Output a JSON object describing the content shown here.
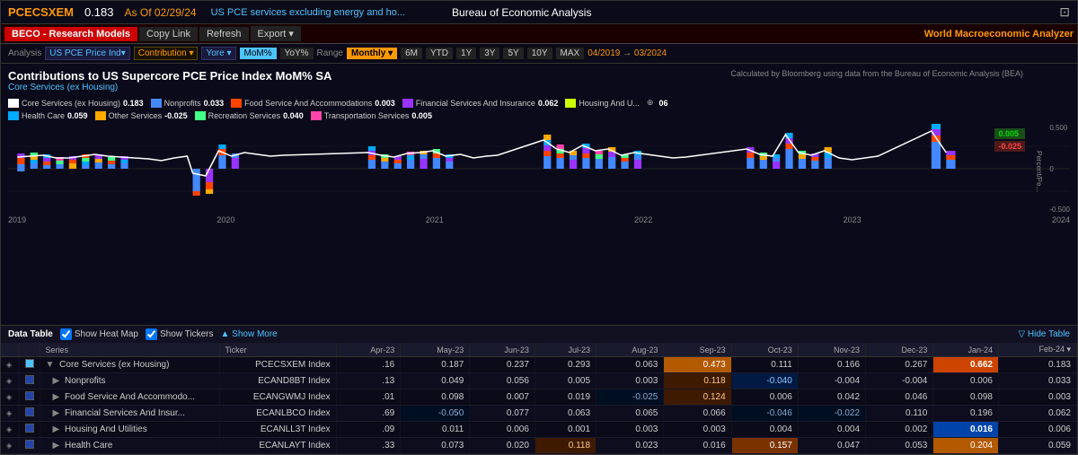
{
  "header": {
    "ticker": "PCECSXEM",
    "value": "0.183",
    "as_of_label": "As Of",
    "date": "02/29/24",
    "series_name": "US PCE services excluding energy and ho...",
    "bureau": "Bureau of Economic Analysis",
    "export_icon": "⊡"
  },
  "toolbar": {
    "beco_label": "BECO - Research Models",
    "copy_link": "Copy Link",
    "refresh": "Refresh",
    "export": "Export ▾",
    "world_macro": "World Macroeconomic Analyzer"
  },
  "analysis_bar": {
    "analysis_label": "Analysis",
    "dropdown1": "US PCE Price Ind▾",
    "dropdown2": "Contribution",
    "dropdown2_arrow": "▾",
    "dropdown3": "Yore",
    "dropdown3_arrow": "▾",
    "mom_btn": "MoM%",
    "yoy_btn": "YoY%",
    "range_label": "Range",
    "monthly_btn": "Monthly ▾",
    "periods": [
      "6M",
      "YTD",
      "1Y",
      "3Y",
      "5Y",
      "10Y",
      "MAX"
    ],
    "date_from": "04/2019",
    "date_arrow": "→",
    "date_to": "03/2024"
  },
  "chart": {
    "title": "Contributions to US Supercore PCE Price Index MoM% SA",
    "subtitle": "Core Services (ex Housing)",
    "attribution": "Calculated by Bloomberg using data from the Bureau of Economic Analysis (BEA)",
    "y_axis": [
      "0.500",
      "",
      "",
      "",
      "0",
      "",
      "",
      "",
      "-0.500"
    ],
    "y_label": "Percent/Pe...",
    "x_axis": [
      "2019",
      "2020",
      "2021",
      "2022",
      "2023",
      "2024"
    ],
    "right_indicators": [
      {
        "value": "0.005",
        "type": "green"
      },
      {
        "value": "-0.025",
        "type": "red"
      }
    ],
    "zoom_label": "+06"
  },
  "legend": [
    {
      "color": "#ffffff",
      "label": "Core Services (ex Housing)",
      "value": "0.183",
      "type": "outline"
    },
    {
      "color": "#4488ff",
      "label": "Nonprofits",
      "value": "0.033"
    },
    {
      "color": "#ff4400",
      "label": "Food Service And Accommodations",
      "value": "0.003"
    },
    {
      "color": "#9933ff",
      "label": "Financial Services And Insurance",
      "value": "0.062"
    },
    {
      "color": "#ccff00",
      "label": "Housing And U...",
      "value": ""
    },
    {
      "color": "#00aaff",
      "label": "Health Care",
      "value": "0.059"
    },
    {
      "color": "#ffaa00",
      "label": "Other Services",
      "value": "-0.025"
    },
    {
      "color": "#44ff88",
      "label": "Recreation Services",
      "value": "0.040"
    },
    {
      "color": "#ff44aa",
      "label": "Transportation Services",
      "value": "0.005"
    }
  ],
  "data_table": {
    "title": "Data Table",
    "show_heat_map": "Show Heat Map",
    "show_tickers": "Show Tickers",
    "show_more": "▲ Show More",
    "hide_table": "▽ Hide Table",
    "columns": [
      "",
      "",
      "Series",
      "Ticker",
      "Apr-23",
      "May-23",
      "Jun-23",
      "Jul-23",
      "Aug-23",
      "Sep-23",
      "Oct-23",
      "Nov-23",
      "Dec-23",
      "Jan-24",
      "Feb-24▾"
    ],
    "rows": [
      {
        "indent": false,
        "name": "Core Services (ex Housing)",
        "ticker": "PCECSXEM Index",
        "values": [
          ".16",
          "0.187",
          "0.237",
          "0.293",
          "0.063",
          "0.473",
          "0.111",
          "0.166",
          "0.267",
          "0.662",
          "0.183"
        ],
        "heat": [
          "neutral",
          "neutral",
          "neutral",
          "neutral",
          "neutral",
          "strong_pos",
          "neutral",
          "neutral",
          "neutral",
          "very_strong_pos",
          "neutral"
        ]
      },
      {
        "indent": true,
        "name": "Nonprofits",
        "ticker": "ECAND8BT Index",
        "values": [
          ".13",
          "0.049",
          "0.056",
          "0.005",
          "0.003",
          "0.118",
          "-0.040",
          "-0.004",
          "-0.004",
          "0.006",
          "0.033"
        ],
        "heat": [
          "neutral",
          "neutral",
          "neutral",
          "neutral",
          "neutral",
          "light_pos",
          "light_neg",
          "neutral",
          "neutral",
          "neutral",
          "neutral"
        ]
      },
      {
        "indent": true,
        "name": "Food Service And Accommodo...",
        "ticker": "ECANGWMJ Index",
        "values": [
          ".01",
          "0.098",
          "0.007",
          "0.019",
          "-0.025",
          "0.124",
          "0.006",
          "0.042",
          "0.046",
          "0.098",
          "0.003"
        ],
        "heat": [
          "neutral",
          "neutral",
          "neutral",
          "neutral",
          "light_neg",
          "light_pos",
          "neutral",
          "neutral",
          "neutral",
          "neutral",
          "neutral"
        ]
      },
      {
        "indent": true,
        "name": "Financial Services And Insur...",
        "ticker": "ECANLBCO Index",
        "values": [
          ".69",
          "-0.050",
          "0.077",
          "0.063",
          "0.065",
          "0.066",
          "-0.046",
          "-0.022",
          "0.110",
          "0.196",
          "0.062"
        ],
        "heat": [
          "neutral",
          "light_neg",
          "neutral",
          "neutral",
          "neutral",
          "neutral",
          "light_neg",
          "light_neg",
          "neutral",
          "neutral",
          "neutral"
        ]
      },
      {
        "indent": true,
        "name": "Housing And Utilities",
        "ticker": "ECANLL3T Index",
        "values": [
          ".09",
          "0.011",
          "0.006",
          "0.001",
          "0.003",
          "0.003",
          "0.004",
          "0.004",
          "0.002",
          "0.016",
          "0.006"
        ],
        "heat": [
          "neutral",
          "neutral",
          "neutral",
          "neutral",
          "neutral",
          "neutral",
          "neutral",
          "neutral",
          "neutral",
          "highlight_blue",
          "neutral"
        ]
      },
      {
        "indent": true,
        "name": "Health Care",
        "ticker": "ECANLAYT Index",
        "values": [
          ".33",
          "0.073",
          "0.020",
          "0.118",
          "0.023",
          "0.016",
          "0.157",
          "0.047",
          "0.053",
          "0.204",
          "0.059"
        ],
        "heat": [
          "neutral",
          "neutral",
          "neutral",
          "light_pos",
          "neutral",
          "neutral",
          "med_pos",
          "neutral",
          "neutral",
          "strong_pos",
          "neutral"
        ]
      }
    ]
  }
}
